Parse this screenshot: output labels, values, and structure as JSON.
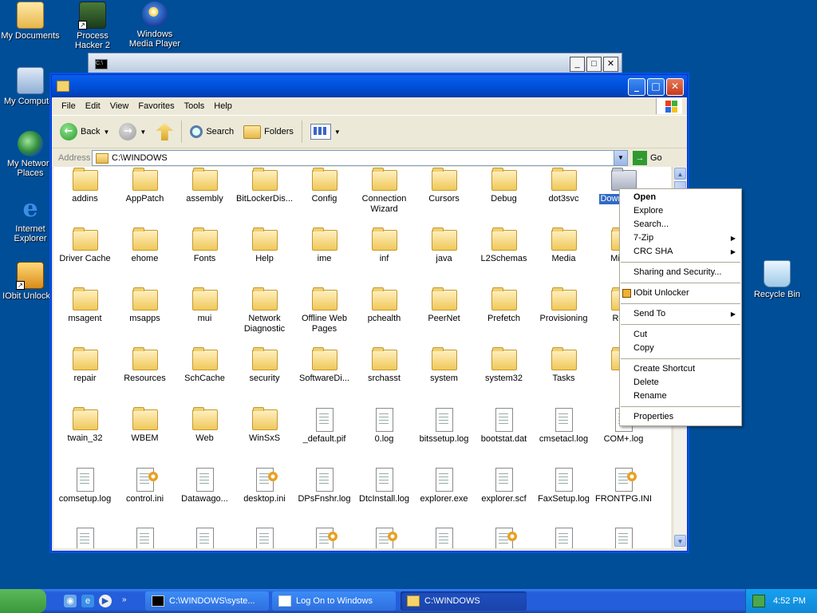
{
  "desktop_icons": [
    {
      "label": "My Documents"
    },
    {
      "label": "Process Hacker 2"
    },
    {
      "label": "Windows Media Player"
    },
    {
      "label": "My Computer"
    },
    {
      "label": "My Network Places"
    },
    {
      "label": "Internet Explorer"
    },
    {
      "label": "IObit Unlocker"
    },
    {
      "label": "Recycle Bin"
    }
  ],
  "bg_window": {
    "title_icon": "C:\\"
  },
  "explorer": {
    "menu": [
      "File",
      "Edit",
      "View",
      "Favorites",
      "Tools",
      "Help"
    ],
    "toolbar": {
      "back": "Back",
      "search": "Search",
      "folders": "Folders"
    },
    "address": {
      "label": "Address",
      "value": "C:\\WINDOWS",
      "go": "Go"
    },
    "items": [
      {
        "label": "addins",
        "type": "folder"
      },
      {
        "label": "AppPatch",
        "type": "folder"
      },
      {
        "label": "assembly",
        "type": "folder"
      },
      {
        "label": "BitLockerDis...",
        "type": "folder"
      },
      {
        "label": "Config",
        "type": "folder"
      },
      {
        "label": "Connection Wizard",
        "type": "folder"
      },
      {
        "label": "Cursors",
        "type": "folder"
      },
      {
        "label": "Debug",
        "type": "folder"
      },
      {
        "label": "dot3svc",
        "type": "folder"
      },
      {
        "label": "Down Progr",
        "type": "folder-selected"
      },
      {
        "label": "Driver Cache",
        "type": "folder"
      },
      {
        "label": "ehome",
        "type": "folder"
      },
      {
        "label": "Fonts",
        "type": "folder"
      },
      {
        "label": "Help",
        "type": "folder"
      },
      {
        "label": "ime",
        "type": "folder"
      },
      {
        "label": "inf",
        "type": "folder"
      },
      {
        "label": "java",
        "type": "folder"
      },
      {
        "label": "L2Schemas",
        "type": "folder"
      },
      {
        "label": "Media",
        "type": "folder"
      },
      {
        "label": "Micros",
        "type": "folder"
      },
      {
        "label": "msagent",
        "type": "folder"
      },
      {
        "label": "msapps",
        "type": "folder"
      },
      {
        "label": "mui",
        "type": "folder"
      },
      {
        "label": "Network Diagnostic",
        "type": "folder"
      },
      {
        "label": "Offline Web Pages",
        "type": "special-folder"
      },
      {
        "label": "pchealth",
        "type": "folder"
      },
      {
        "label": "PeerNet",
        "type": "folder"
      },
      {
        "label": "Prefetch",
        "type": "folder"
      },
      {
        "label": "Provisioning",
        "type": "folder"
      },
      {
        "label": "Regis",
        "type": "folder"
      },
      {
        "label": "repair",
        "type": "folder"
      },
      {
        "label": "Resources",
        "type": "folder"
      },
      {
        "label": "SchCache",
        "type": "folder"
      },
      {
        "label": "security",
        "type": "folder"
      },
      {
        "label": "SoftwareDi...",
        "type": "folder"
      },
      {
        "label": "srchasst",
        "type": "folder"
      },
      {
        "label": "system",
        "type": "folder"
      },
      {
        "label": "system32",
        "type": "folder"
      },
      {
        "label": "Tasks",
        "type": "tasks-folder"
      },
      {
        "label": "Te",
        "type": "folder"
      },
      {
        "label": "twain_32",
        "type": "folder"
      },
      {
        "label": "WBEM",
        "type": "folder"
      },
      {
        "label": "Web",
        "type": "folder"
      },
      {
        "label": "WinSxS",
        "type": "folder"
      },
      {
        "label": "_default.pif",
        "type": "pif"
      },
      {
        "label": "0.log",
        "type": "file"
      },
      {
        "label": "bitssetup.log",
        "type": "file"
      },
      {
        "label": "bootstat.dat",
        "type": "file"
      },
      {
        "label": "cmsetacl.log",
        "type": "file"
      },
      {
        "label": "COM+.log",
        "type": "file"
      },
      {
        "label": "comsetup.log",
        "type": "file"
      },
      {
        "label": "control.ini",
        "type": "ini"
      },
      {
        "label": "Datawago...",
        "type": "image"
      },
      {
        "label": "desktop.ini",
        "type": "ini"
      },
      {
        "label": "DPsFnshr.log",
        "type": "file"
      },
      {
        "label": "DtcInstall.log",
        "type": "file"
      },
      {
        "label": "explorer.exe",
        "type": "exe"
      },
      {
        "label": "explorer.scf",
        "type": "scf"
      },
      {
        "label": "FaxSetup.log",
        "type": "file"
      },
      {
        "label": "FRONTPG.INI",
        "type": "ini"
      },
      {
        "label": "",
        "type": "help"
      },
      {
        "label": "",
        "type": "file"
      },
      {
        "label": "",
        "type": "file"
      },
      {
        "label": "",
        "type": "file"
      },
      {
        "label": "",
        "type": "ini"
      },
      {
        "label": "",
        "type": "ini"
      },
      {
        "label": "",
        "type": "file"
      },
      {
        "label": "",
        "type": "ini"
      },
      {
        "label": "",
        "type": "file"
      },
      {
        "label": "",
        "type": "file"
      }
    ]
  },
  "context_menu": [
    {
      "label": "Open",
      "bold": true
    },
    {
      "label": "Explore"
    },
    {
      "label": "Search..."
    },
    {
      "label": "7-Zip",
      "submenu": true
    },
    {
      "label": "CRC SHA",
      "submenu": true
    },
    {
      "sep": true
    },
    {
      "label": "Sharing and Security..."
    },
    {
      "sep": true
    },
    {
      "label": "IObit Unlocker",
      "icon": "lock-icon"
    },
    {
      "sep": true
    },
    {
      "label": "Send To",
      "submenu": true
    },
    {
      "sep": true
    },
    {
      "label": "Cut"
    },
    {
      "label": "Copy"
    },
    {
      "sep": true
    },
    {
      "label": "Create Shortcut"
    },
    {
      "label": "Delete"
    },
    {
      "label": "Rename"
    },
    {
      "sep": true
    },
    {
      "label": "Properties"
    }
  ],
  "taskbar": {
    "tasks": [
      {
        "label": "C:\\WINDOWS\\syste..."
      },
      {
        "label": "Log On to Windows"
      },
      {
        "label": "C:\\WINDOWS"
      }
    ],
    "clock": "4:52 PM"
  }
}
